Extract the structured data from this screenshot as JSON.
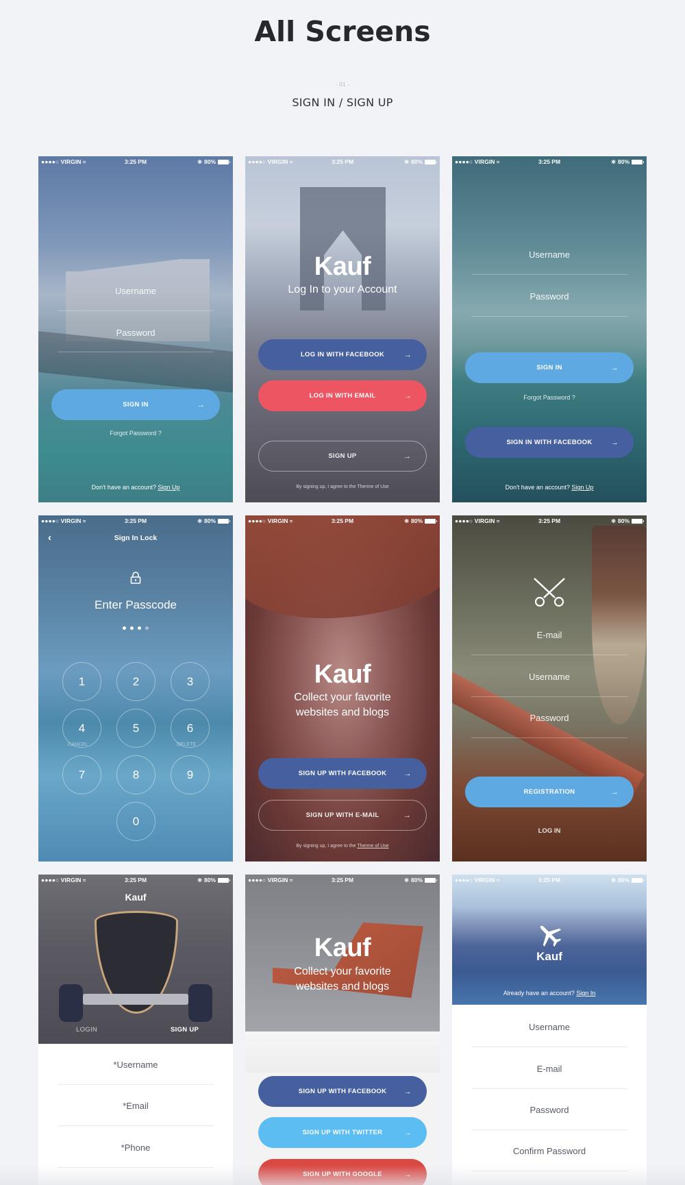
{
  "header": {
    "title": "All Screens",
    "section_number": "- 01 -",
    "section_title": "SIGN IN / SIGN UP"
  },
  "statusbar": {
    "carrier": "●●●●○ VIRGIN",
    "wifi_icon": "wifi-icon",
    "time": "3:25 PM",
    "bluetooth_icon": "bluetooth-icon",
    "battery": "80%"
  },
  "screens": {
    "s1": {
      "username_placeholder": "Username",
      "password_placeholder": "Password",
      "signin_label": "SIGN IN",
      "forgot": "Forgot Password ?",
      "no_account": "Don't have an account?",
      "signup_link": "Sign Up"
    },
    "s2": {
      "brand": "Kauf",
      "subtitle": "Log In to your Account",
      "facebook_label": "LOG IN WITH FACEBOOK",
      "email_label": "LOG IN WITH EMAIL",
      "signup_label": "SIGN UP",
      "terms_prefix": "By signing up, I agree to the",
      "terms_link": "Therme of Use"
    },
    "s3": {
      "username_placeholder": "Username",
      "password_placeholder": "Password",
      "signin_label": "SIGN IN",
      "forgot": "Forgot Password ?",
      "facebook_label": "SIGN IN WITH FACEBOOK",
      "no_account": "Don't have an account?",
      "signup_link": "Sign Up"
    },
    "s4": {
      "nav_title": "Sign In Lock",
      "prompt": "Enter Passcode",
      "passcode_filled": 3,
      "passcode_length": 4,
      "keys": [
        "1",
        "2",
        "3",
        "4",
        "5",
        "6",
        "7",
        "8",
        "9",
        "0"
      ],
      "cancel": "CANCEL",
      "delete": "DELETE"
    },
    "s5": {
      "brand": "Kauf",
      "subtitle_line1": "Collect your favorite",
      "subtitle_line2": "websites and blogs",
      "facebook_label": "SIGN UP WITH FACEBOOK",
      "email_label": "SIGN UP WITH E-MAIL",
      "terms_prefix": "By signing up, I agree to the",
      "terms_link": "Therme of Use"
    },
    "s6": {
      "email_placeholder": "E-mail",
      "username_placeholder": "Username",
      "password_placeholder": "Password",
      "registration_label": "REGISTRATION",
      "login_label": "LOG IN"
    },
    "s7": {
      "brand": "Kauf",
      "tab_login": "LOGIN",
      "tab_signup": "SIGN UP",
      "username_placeholder": "*Username",
      "email_placeholder": "*Email",
      "phone_placeholder": "*Phone"
    },
    "s8": {
      "brand": "Kauf",
      "subtitle_line1": "Collect your favorite",
      "subtitle_line2": "websites and blogs",
      "facebook_label": "SIGN UP WITH FACEBOOK",
      "twitter_label": "SIGN UP WITH TWITTER",
      "google_label": "SIGN UP WITH GOOGLE"
    },
    "s9": {
      "brand": "Kauf",
      "already": "Already have an account?",
      "signin_link": "Sign In",
      "username_placeholder": "Username",
      "email_placeholder": "E-mail",
      "password_placeholder": "Password",
      "confirm_placeholder": "Confirm Password"
    }
  },
  "colors": {
    "page_bg": "#f2f3f7",
    "title": "#26282c",
    "primary_blue": "#5ea9e2",
    "facebook": "#46609f",
    "email_red": "#ee5562",
    "twitter": "#5bbdf2",
    "google": "#d94843"
  }
}
